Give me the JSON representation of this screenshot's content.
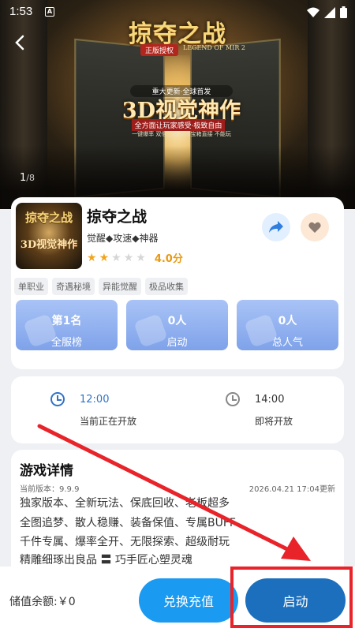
{
  "status_bar": {
    "time": "1:53",
    "notif_glyph": "A"
  },
  "banner": {
    "title_art": "掠夺之战",
    "subtitle_badge": "正版授权",
    "subtitle_en": "LEGEND OF MIR 2",
    "promo_line_1": "重大更新·全球首发",
    "promo_big": "3D视觉神作",
    "promo_line_2": "全方面让玩家感受·极致自由",
    "promo_line_3": "一键爆率 双倍三倍 高爆宝箱直接 不能玩",
    "page_current": "1",
    "page_total": "/8"
  },
  "game": {
    "thumb_line_1": "掠夺之战",
    "thumb_line_2": "3D视觉神作",
    "name": "掠夺之战",
    "features": "觉醒◆攻速◆神器",
    "rating": 2,
    "rating_max": 5,
    "score_label": "4.0分",
    "tags": [
      "单职业",
      "奇遇秘境",
      "异能觉醒",
      "极品收集"
    ],
    "stats": [
      {
        "value": "第1名",
        "label": "全服榜"
      },
      {
        "value": "0人",
        "label": "启动"
      },
      {
        "value": "0人",
        "label": "总人气"
      }
    ]
  },
  "schedule": {
    "now_time": "12:00",
    "now_label": "当前正在开放",
    "next_time": "14:00",
    "next_label": "即将开放"
  },
  "details": {
    "title": "游戏详情",
    "version": "当前版本：9.9.9",
    "updated": "2026.04.21 17:04更新",
    "lines": [
      "独家版本、全新玩法、保底回收、老板超多",
      "全图追梦、散人稳赚、装备保值、专属BUFF",
      "千件专属、爆率全开、无限探索、超级耐玩",
      "精雕细琢出良品 〓 巧手匠心塑灵魂"
    ]
  },
  "bottom": {
    "balance": "储值余额:￥0",
    "redeem_label": "兑换充值",
    "launch_label": "启动"
  },
  "colors": {
    "accent_blue": "#1a9af0",
    "launch_blue": "#1b6fbd",
    "star_gold": "#f2a41c",
    "annotation_red": "#e8232a"
  }
}
